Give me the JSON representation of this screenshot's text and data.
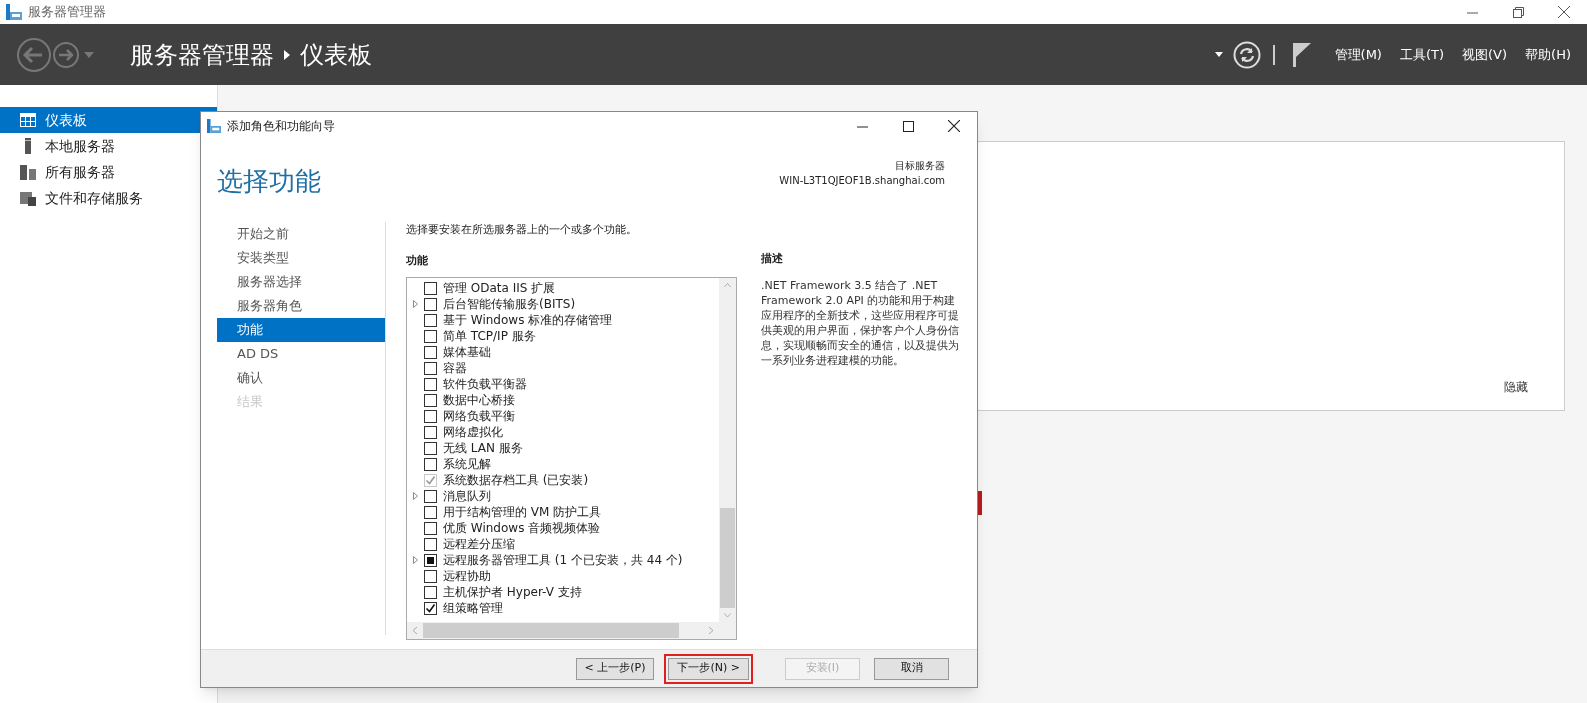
{
  "window": {
    "title": "服务器管理器"
  },
  "header": {
    "title": "服务器管理器",
    "page": "仪表板",
    "menus": [
      "管理(M)",
      "工具(T)",
      "视图(V)",
      "帮助(H)"
    ]
  },
  "sidebar": {
    "items": [
      {
        "label": "仪表板",
        "kind": "grid",
        "selected": true
      },
      {
        "label": "本地服务器",
        "kind": "server",
        "selected": false
      },
      {
        "label": "所有服务器",
        "kind": "servers",
        "selected": false
      },
      {
        "label": "文件和存储服务",
        "kind": "files",
        "selected": false
      }
    ]
  },
  "dashboard": {
    "hide_link": "隐藏"
  },
  "dialog": {
    "title": "添加角色和功能向导",
    "heading": "选择功能",
    "target_label": "目标服务器",
    "target_server": "WIN-L3T1QJEOF1B.shanghai.com",
    "steps": [
      {
        "label": "开始之前",
        "selected": false,
        "disabled": false
      },
      {
        "label": "安装类型",
        "selected": false,
        "disabled": false
      },
      {
        "label": "服务器选择",
        "selected": false,
        "disabled": false
      },
      {
        "label": "服务器角色",
        "selected": false,
        "disabled": false
      },
      {
        "label": "功能",
        "selected": true,
        "disabled": false
      },
      {
        "label": "AD DS",
        "selected": false,
        "disabled": false
      },
      {
        "label": "确认",
        "selected": false,
        "disabled": false
      },
      {
        "label": "结果",
        "selected": false,
        "disabled": true
      }
    ],
    "instruction": "选择要安装在所选服务器上的一个或多个功能。",
    "features_label": "功能",
    "features": [
      {
        "label": "管理 OData IIS 扩展",
        "expandable": false,
        "checked": false,
        "indeterminate": false,
        "disabled": false
      },
      {
        "label": "后台智能传输服务(BITS)",
        "expandable": true,
        "checked": false,
        "indeterminate": false,
        "disabled": false
      },
      {
        "label": "基于 Windows 标准的存储管理",
        "expandable": false,
        "checked": false,
        "indeterminate": false,
        "disabled": false
      },
      {
        "label": "简单 TCP/IP 服务",
        "expandable": false,
        "checked": false,
        "indeterminate": false,
        "disabled": false
      },
      {
        "label": "媒体基础",
        "expandable": false,
        "checked": false,
        "indeterminate": false,
        "disabled": false
      },
      {
        "label": "容器",
        "expandable": false,
        "checked": false,
        "indeterminate": false,
        "disabled": false
      },
      {
        "label": "软件负载平衡器",
        "expandable": false,
        "checked": false,
        "indeterminate": false,
        "disabled": false
      },
      {
        "label": "数据中心桥接",
        "expandable": false,
        "checked": false,
        "indeterminate": false,
        "disabled": false
      },
      {
        "label": "网络负载平衡",
        "expandable": false,
        "checked": false,
        "indeterminate": false,
        "disabled": false
      },
      {
        "label": "网络虚拟化",
        "expandable": false,
        "checked": false,
        "indeterminate": false,
        "disabled": false
      },
      {
        "label": "无线 LAN 服务",
        "expandable": false,
        "checked": false,
        "indeterminate": false,
        "disabled": false
      },
      {
        "label": "系统见解",
        "expandable": false,
        "checked": false,
        "indeterminate": false,
        "disabled": false
      },
      {
        "label": "系统数据存档工具 (已安装)",
        "expandable": false,
        "checked": true,
        "indeterminate": false,
        "disabled": true
      },
      {
        "label": "消息队列",
        "expandable": true,
        "checked": false,
        "indeterminate": false,
        "disabled": false
      },
      {
        "label": "用于结构管理的 VM 防护工具",
        "expandable": false,
        "checked": false,
        "indeterminate": false,
        "disabled": false
      },
      {
        "label": "优质 Windows 音频视频体验",
        "expandable": false,
        "checked": false,
        "indeterminate": false,
        "disabled": false
      },
      {
        "label": "远程差分压缩",
        "expandable": false,
        "checked": false,
        "indeterminate": false,
        "disabled": false
      },
      {
        "label": "远程服务器管理工具 (1 个已安装，共 44 个)",
        "expandable": true,
        "checked": false,
        "indeterminate": true,
        "disabled": false
      },
      {
        "label": "远程协助",
        "expandable": false,
        "checked": false,
        "indeterminate": false,
        "disabled": false
      },
      {
        "label": "主机保护者 Hyper-V 支持",
        "expandable": false,
        "checked": false,
        "indeterminate": false,
        "disabled": false
      },
      {
        "label": "组策略管理",
        "expandable": false,
        "checked": true,
        "indeterminate": false,
        "disabled": false
      }
    ],
    "description_label": "描述",
    "description": ".NET Framework 3.5 结合了 .NET Framework 2.0 API 的功能和用于构建应用程序的全新技术，这些应用程序可提供美观的用户界面，保护客户个人身份信息，实现顺畅而安全的通信，以及提供为一系列业务进程建模的功能。",
    "buttons": [
      {
        "label": "< 上一步(P)",
        "disabled": false,
        "highlighted": false
      },
      {
        "label": "下一步(N) >",
        "disabled": false,
        "highlighted": true
      },
      {
        "label": "安装(I)",
        "disabled": true,
        "highlighted": false
      },
      {
        "label": "取消",
        "disabled": false,
        "highlighted": false
      }
    ]
  }
}
